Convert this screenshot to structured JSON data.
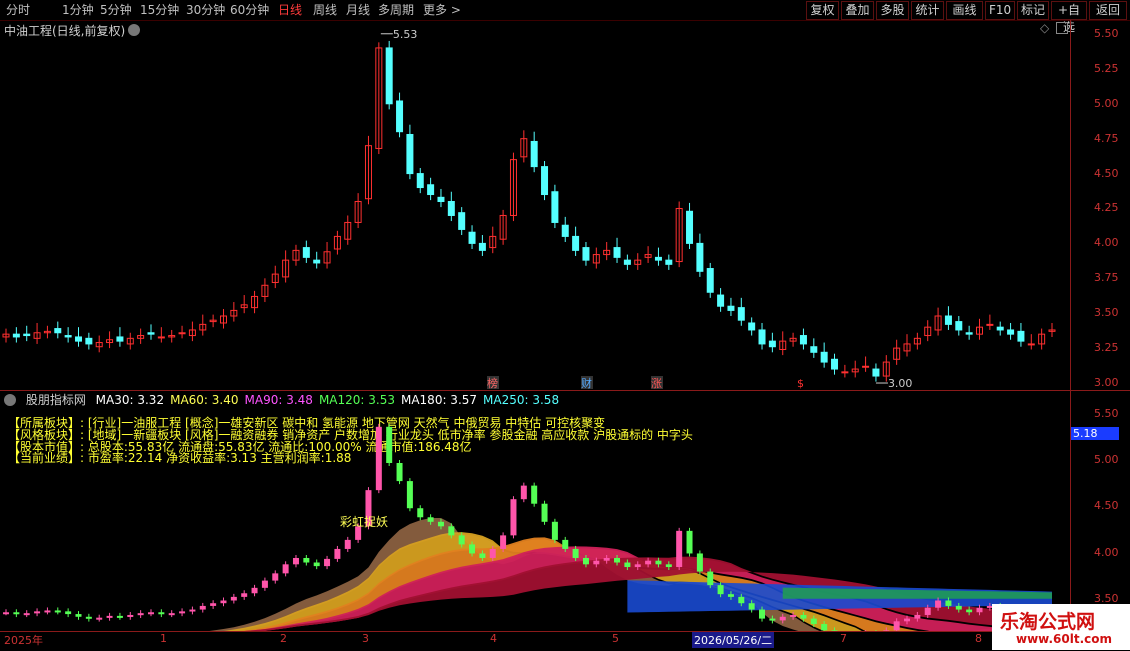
{
  "toolbar": {
    "timeframes": [
      "分时",
      "1分钟",
      "5分钟",
      "15分钟",
      "30分钟",
      "60分钟",
      "日线",
      "周线",
      "月线",
      "多周期",
      "更多 >"
    ],
    "active": "日线",
    "buttons": [
      "复权",
      "叠加",
      "多股",
      "统计",
      "画线",
      "F10",
      "标记",
      "+自选",
      "返回"
    ]
  },
  "main_chart": {
    "title": "中油工程(日线,前复权)",
    "y_ticks": [
      "5.50",
      "5.25",
      "5.00",
      "4.75",
      "4.50",
      "4.25",
      "4.00",
      "3.75",
      "3.50",
      "3.25",
      "3.00"
    ],
    "high_label": "5.53",
    "low_label": "3.00",
    "markers": [
      "榜",
      "财",
      "涨",
      "$"
    ]
  },
  "indicator": {
    "name": "股朋指标网",
    "mas": [
      {
        "label": "MA30: 3.32",
        "color": "#ffffff"
      },
      {
        "label": "MA60: 3.40",
        "color": "#ffff55"
      },
      {
        "label": "MA90: 3.48",
        "color": "#ff55ff"
      },
      {
        "label": "MA120: 3.53",
        "color": "#55ff55"
      },
      {
        "label": "MA180: 3.57",
        "color": "#ffffff"
      },
      {
        "label": "MA250: 3.58",
        "color": "#55ffff"
      }
    ],
    "info_lines": [
      "【所属板块】: [行业]一油服工程 [概念]一雄安新区 碳中和 氢能源 地下管网 天然气 中俄贸易 中特估 可控核聚变",
      "【风格板块】: [地域]一新疆板块 [风格]一融资融券 销净资产 户数增加 行业龙头 低市净率 参股金融 高应收款 沪股通标的 中字头",
      "【股本市值】: 总股本:55.83亿 流通盘:55.83亿 流通比:100.00% 流通市值:186.48亿",
      "【当前业绩】: 市盈率:22.14 净资收益率:3.13 主营利润率:1.88"
    ],
    "annotation": "彩虹捉妖",
    "y_ticks": [
      "5.50",
      "5.00",
      "4.50",
      "4.00",
      "3.50"
    ],
    "current_value": "5.18"
  },
  "x_axis": {
    "labels": [
      "2025年",
      "1",
      "2",
      "3",
      "4",
      "5",
      "2026/05/26/二",
      "7",
      "8"
    ]
  },
  "watermark": {
    "title": "乐淘公式网",
    "url": "www.60lt.com"
  },
  "chart_data": {
    "type": "candlestick",
    "title": "中油工程(日线,前复权)",
    "ylim": [
      2.95,
      5.6
    ],
    "high": 5.53,
    "low": 3.0,
    "close_series": [
      3.35,
      3.33,
      3.34,
      3.36,
      3.37,
      3.36,
      3.33,
      3.3,
      3.28,
      3.29,
      3.31,
      3.3,
      3.32,
      3.34,
      3.35,
      3.33,
      3.34,
      3.36,
      3.38,
      3.42,
      3.45,
      3.48,
      3.52,
      3.56,
      3.62,
      3.7,
      3.78,
      3.88,
      3.95,
      3.9,
      3.86,
      3.94,
      4.05,
      4.15,
      4.3,
      4.7,
      5.4,
      5.0,
      4.8,
      4.5,
      4.4,
      4.35,
      4.3,
      4.2,
      4.1,
      4.0,
      3.95,
      4.05,
      4.2,
      4.6,
      4.75,
      4.55,
      4.35,
      4.15,
      4.05,
      3.95,
      3.88,
      3.92,
      3.95,
      3.9,
      3.85,
      3.88,
      3.92,
      3.88,
      3.85,
      4.25,
      4.0,
      3.8,
      3.65,
      3.55,
      3.52,
      3.45,
      3.38,
      3.28,
      3.26,
      3.3,
      3.32,
      3.28,
      3.22,
      3.15,
      3.1,
      3.08,
      3.1,
      3.12,
      3.05,
      3.15,
      3.25,
      3.28,
      3.32,
      3.4,
      3.48,
      3.42,
      3.38,
      3.35,
      3.4,
      3.42,
      3.38,
      3.35,
      3.3,
      3.28,
      3.35,
      3.38
    ]
  }
}
